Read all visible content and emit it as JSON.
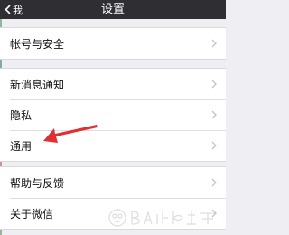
{
  "navbar": {
    "back_label": "我",
    "title": "设置"
  },
  "groups": [
    {
      "items": [
        {
          "label": "帐号与安全"
        }
      ]
    },
    {
      "items": [
        {
          "label": "新消息通知"
        },
        {
          "label": "隐私"
        },
        {
          "label": "通用"
        }
      ]
    },
    {
      "items": [
        {
          "label": "帮助与反馈"
        },
        {
          "label": "关于微信"
        }
      ]
    }
  ],
  "colors": {
    "navbar_bg": "#2f2f33",
    "page_bg": "#eeeef3",
    "annotation_arrow": "#e03030"
  }
}
